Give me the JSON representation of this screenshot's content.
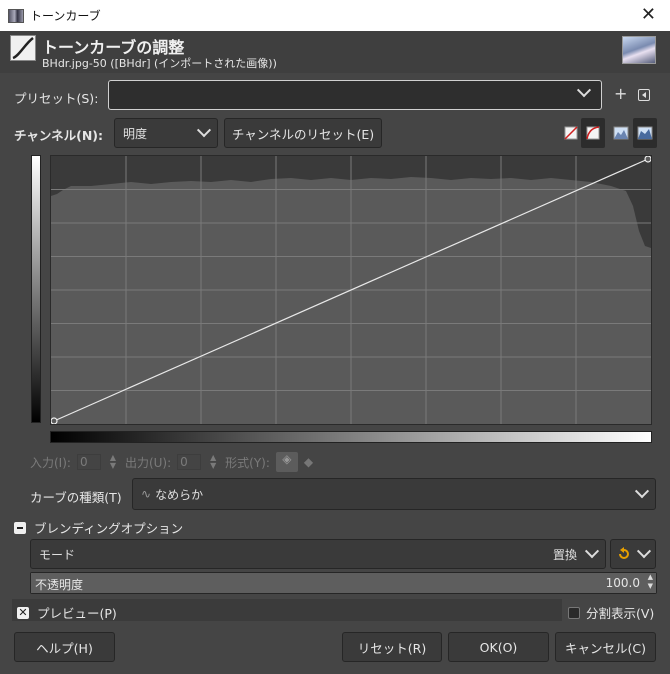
{
  "window": {
    "title": "トーンカーブ",
    "close_glyph": "✕"
  },
  "header": {
    "title": "トーンカーブの調整",
    "subtitle": "BHdr.jpg-50 ([BHdr] (インポートされた画像))"
  },
  "preset": {
    "label": "プリセット(S):",
    "value": "",
    "add_glyph": "+"
  },
  "channel": {
    "label": "チャンネル(N):",
    "value": "明度",
    "reset_label": "チャンネルのリセット(E)"
  },
  "point": {
    "input_label": "入力(I):",
    "input_value": "0",
    "output_label": "出力(U):",
    "output_value": "0",
    "type_label": "形式(Y):"
  },
  "curve_type": {
    "label": "カーブの種類(T)",
    "value": "なめらか",
    "icon_glyph": "∿"
  },
  "blending": {
    "section_label": "ブレンディングオプション",
    "mode_label": "モード",
    "mode_value": "置換",
    "opacity_label": "不透明度",
    "opacity_value": "100.0",
    "opacity_fraction": 1.0
  },
  "preview": {
    "label": "プレビュー(P)",
    "checked": true,
    "split_label": "分割表示(V)",
    "split_checked": false
  },
  "buttons": {
    "help": "ヘルプ(H)",
    "reset": "リセット(R)",
    "ok": "OK(O)",
    "cancel": "キャンセル(C)"
  },
  "colors": {
    "accent_orange": "#e8a000",
    "reset_red": "#d02020"
  }
}
